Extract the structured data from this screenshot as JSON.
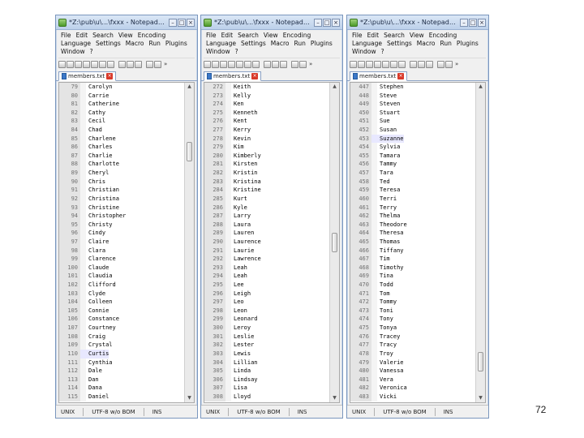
{
  "windows": [
    {
      "title": "*Z:\\pub\\u\\...\\fxxx - Notepad++",
      "menu": [
        "File",
        "Edit",
        "Search",
        "View",
        "Encoding",
        "Language",
        "Settings",
        "Macro",
        "Run",
        "Plugins",
        "Window",
        "?"
      ],
      "tab": "members.txt",
      "lines": [
        [
          "79",
          "Carolyn"
        ],
        [
          "80",
          "Carrie"
        ],
        [
          "81",
          "Catherine"
        ],
        [
          "82",
          "Cathy"
        ],
        [
          "83",
          "Cecil"
        ],
        [
          "84",
          "Chad"
        ],
        [
          "85",
          "Charlene"
        ],
        [
          "86",
          "Charles"
        ],
        [
          "87",
          "Charlie"
        ],
        [
          "88",
          "Charlotte"
        ],
        [
          "89",
          "Cheryl"
        ],
        [
          "90",
          "Chris"
        ],
        [
          "91",
          "Christian"
        ],
        [
          "92",
          "Christina"
        ],
        [
          "93",
          "Christine"
        ],
        [
          "94",
          "Christopher"
        ],
        [
          "95",
          "Christy"
        ],
        [
          "96",
          "Cindy"
        ],
        [
          "97",
          "Claire"
        ],
        [
          "98",
          "Clara"
        ],
        [
          "99",
          "Clarence"
        ],
        [
          "100",
          "Claude"
        ],
        [
          "101",
          "Claudia"
        ],
        [
          "102",
          "Clifford"
        ],
        [
          "103",
          "Clyde"
        ],
        [
          "104",
          "Colleen"
        ],
        [
          "105",
          "Connie"
        ],
        [
          "106",
          "Constance"
        ],
        [
          "107",
          "Courtney"
        ],
        [
          "108",
          "Craig"
        ],
        [
          "109",
          "Crystal"
        ],
        [
          "110",
          "Curtis"
        ],
        [
          "111",
          "Cynthia"
        ],
        [
          "112",
          "Dale"
        ],
        [
          "113",
          "Dan"
        ],
        [
          "114",
          "Dana"
        ],
        [
          "115",
          "Daniel"
        ]
      ],
      "highlight_index": 31,
      "scroll_position": 0.18,
      "status": {
        "eol": "UNIX",
        "encoding": "UTF-8 w/o BOM",
        "mode": "INS"
      }
    },
    {
      "title": "*Z:\\pub\\u\\...\\fxxx - Notepad++",
      "menu": [
        "File",
        "Edit",
        "Search",
        "View",
        "Encoding",
        "Language",
        "Settings",
        "Macro",
        "Run",
        "Plugins",
        "Window",
        "?"
      ],
      "tab": "members.txt",
      "lines": [
        [
          "272",
          "Keith"
        ],
        [
          "273",
          "Kelly"
        ],
        [
          "274",
          "Ken"
        ],
        [
          "275",
          "Kenneth"
        ],
        [
          "276",
          "Kent"
        ],
        [
          "277",
          "Kerry"
        ],
        [
          "278",
          "Kevin"
        ],
        [
          "279",
          "Kim"
        ],
        [
          "280",
          "Kimberly"
        ],
        [
          "281",
          "Kirsten"
        ],
        [
          "282",
          "Kristin"
        ],
        [
          "283",
          "Kristina"
        ],
        [
          "284",
          "Kristine"
        ],
        [
          "285",
          "Kurt"
        ],
        [
          "286",
          "Kyle"
        ],
        [
          "287",
          "Larry"
        ],
        [
          "288",
          "Laura"
        ],
        [
          "289",
          "Lauren"
        ],
        [
          "290",
          "Laurence"
        ],
        [
          "291",
          "Laurie"
        ],
        [
          "292",
          "Lawrence"
        ],
        [
          "293",
          "Leah"
        ],
        [
          "294",
          "Leah"
        ],
        [
          "295",
          "Lee"
        ],
        [
          "296",
          "Leigh"
        ],
        [
          "297",
          "Leo"
        ],
        [
          "298",
          "Leon"
        ],
        [
          "299",
          "Leonard"
        ],
        [
          "300",
          "Leroy"
        ],
        [
          "301",
          "Leslie"
        ],
        [
          "302",
          "Lester"
        ],
        [
          "303",
          "Lewis"
        ],
        [
          "304",
          "Lillian"
        ],
        [
          "305",
          "Linda"
        ],
        [
          "306",
          "Lindsay"
        ],
        [
          "307",
          "Lisa"
        ],
        [
          "308",
          "Lloyd"
        ]
      ],
      "highlight_index": -1,
      "scroll_position": 0.5,
      "status": {
        "eol": "UNIX",
        "encoding": "UTF-8 w/o BOM",
        "mode": "INS"
      }
    },
    {
      "title": "*Z:\\pub\\u\\...\\fxxx - Notepad++",
      "menu": [
        "File",
        "Edit",
        "Search",
        "View",
        "Encoding",
        "Language",
        "Settings",
        "Macro",
        "Run",
        "Plugins",
        "Window",
        "?"
      ],
      "tab": "members.txt",
      "lines": [
        [
          "447",
          "Stephen"
        ],
        [
          "448",
          "Steve"
        ],
        [
          "449",
          "Steven"
        ],
        [
          "450",
          "Stuart"
        ],
        [
          "451",
          "Sue"
        ],
        [
          "452",
          "Susan"
        ],
        [
          "453",
          "Suzanne"
        ],
        [
          "454",
          "Sylvia"
        ],
        [
          "455",
          "Tamara"
        ],
        [
          "456",
          "Tammy"
        ],
        [
          "457",
          "Tara"
        ],
        [
          "458",
          "Ted"
        ],
        [
          "459",
          "Teresa"
        ],
        [
          "460",
          "Terri"
        ],
        [
          "461",
          "Terry"
        ],
        [
          "462",
          "Thelma"
        ],
        [
          "463",
          "Theodore"
        ],
        [
          "464",
          "Theresa"
        ],
        [
          "465",
          "Thomas"
        ],
        [
          "466",
          "Tiffany"
        ],
        [
          "467",
          "Tim"
        ],
        [
          "468",
          "Timothy"
        ],
        [
          "469",
          "Tina"
        ],
        [
          "470",
          "Todd"
        ],
        [
          "471",
          "Tom"
        ],
        [
          "472",
          "Tommy"
        ],
        [
          "473",
          "Toni"
        ],
        [
          "474",
          "Tony"
        ],
        [
          "475",
          "Tonya"
        ],
        [
          "476",
          "Tracey"
        ],
        [
          "477",
          "Tracy"
        ],
        [
          "478",
          "Troy"
        ],
        [
          "479",
          "Valerie"
        ],
        [
          "480",
          "Vanessa"
        ],
        [
          "481",
          "Vera"
        ],
        [
          "482",
          "Veronica"
        ],
        [
          "483",
          "Vicki"
        ]
      ],
      "highlight_index": 6,
      "scroll_position": 0.92,
      "status": {
        "eol": "UNIX",
        "encoding": "UTF-8 w/o BOM",
        "mode": "INS"
      }
    }
  ],
  "page_number": "72"
}
